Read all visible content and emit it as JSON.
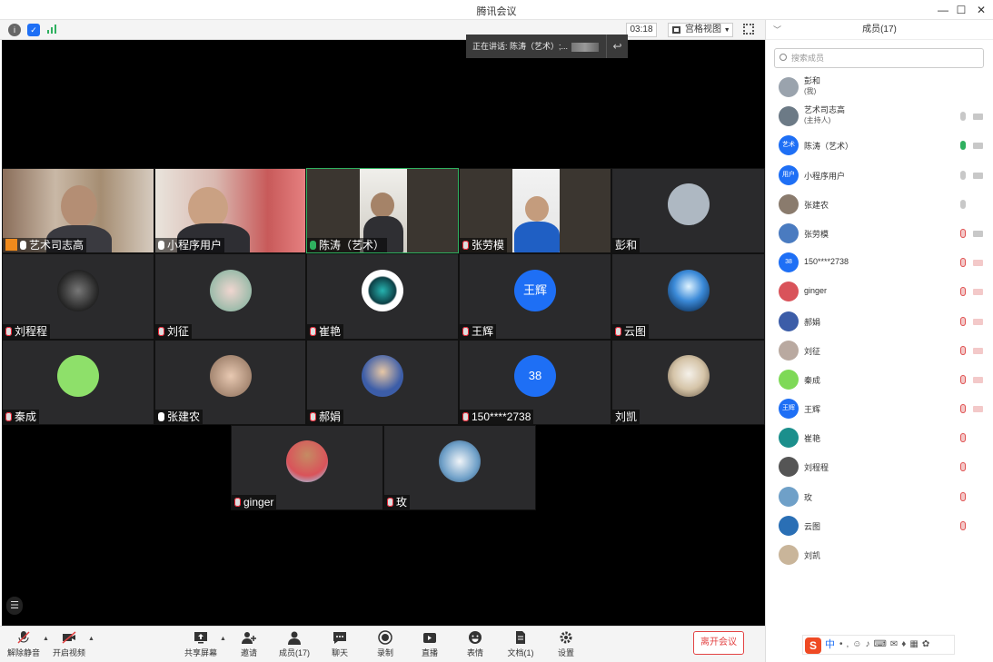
{
  "window": {
    "title": "腾讯会议"
  },
  "toolbar": {
    "timer": "03:18",
    "view_label": "宫格视图"
  },
  "speaker": {
    "prefix": "正在讲话: 陈涛（艺术）;..."
  },
  "colors": {
    "accent": "#1e6ff5",
    "danger": "#e34444",
    "active_border": "#2fb05f",
    "mic_on": "#2fb05f",
    "mic_muted": "#e05050"
  },
  "tiles": [
    {
      "name": "艺术司志高",
      "mic": "on",
      "host": true,
      "type": "video"
    },
    {
      "name": "小程序用户",
      "mic": "on",
      "type": "video"
    },
    {
      "name": "陈涛（艺术）",
      "mic": "on",
      "type": "video",
      "active": true
    },
    {
      "name": "张劳模",
      "mic": "muted",
      "type": "video"
    },
    {
      "name": "彭和",
      "mic": "none",
      "type": "avatar"
    },
    {
      "name": "刘程程",
      "mic": "muted",
      "type": "avatar"
    },
    {
      "name": "刘征",
      "mic": "muted",
      "type": "avatar"
    },
    {
      "name": "崔艳",
      "mic": "muted",
      "type": "avatar"
    },
    {
      "name": "王辉",
      "mic": "muted",
      "type": "avatar",
      "avatar_text": "王辉"
    },
    {
      "name": "云图",
      "mic": "muted",
      "type": "avatar"
    },
    {
      "name": "秦成",
      "mic": "muted",
      "type": "avatar"
    },
    {
      "name": "张建农",
      "mic": "on",
      "type": "avatar"
    },
    {
      "name": "郝娟",
      "mic": "muted",
      "type": "avatar"
    },
    {
      "name": "150****2738",
      "mic": "muted",
      "type": "avatar",
      "avatar_text": "38"
    },
    {
      "name": "刘凯",
      "mic": "none",
      "type": "avatar"
    },
    {
      "name": "ginger",
      "mic": "muted",
      "type": "avatar"
    },
    {
      "name": "玫",
      "mic": "muted",
      "type": "avatar"
    }
  ],
  "bottom": {
    "unmute": "解除静音",
    "video": "开启视频",
    "share": "共享屏幕",
    "invite": "邀请",
    "members": "成员(17)",
    "chat": "聊天",
    "record": "录制",
    "live": "直播",
    "reactions": "表情",
    "docs": "文档(1)",
    "settings": "设置",
    "leave": "离开会议"
  },
  "panel": {
    "title": "成员(17)",
    "search_placeholder": "搜索成员",
    "members": [
      {
        "name": "彭和",
        "sub": "(我)",
        "mic": "none",
        "cam": "none",
        "avatar_color": "#9aa3ad"
      },
      {
        "name": "艺术司志高",
        "sub": "(主持人)",
        "mic": "off-gray",
        "cam": "gray",
        "avatar_color": "#6c7a86"
      },
      {
        "name": "陈涛（艺术）",
        "mic": "on",
        "cam": "gray",
        "avatar_color": "#1e6ff5",
        "avatar_text": "艺术"
      },
      {
        "name": "小程序用户",
        "mic": "off-gray",
        "cam": "gray",
        "avatar_color": "#1e6ff5",
        "avatar_text": "用户"
      },
      {
        "name": "张建农",
        "mic": "off-gray",
        "cam": "none",
        "avatar_color": "#8a7b6d"
      },
      {
        "name": "张劳模",
        "mic": "muted",
        "cam": "gray",
        "avatar_color": "#4a7bc0"
      },
      {
        "name": "150****2738",
        "mic": "muted",
        "cam": "muted",
        "avatar_color": "#1e6ff5",
        "avatar_text": "38"
      },
      {
        "name": "ginger",
        "mic": "muted",
        "cam": "muted",
        "avatar_color": "#d9535a"
      },
      {
        "name": "郝娟",
        "mic": "muted",
        "cam": "muted",
        "avatar_color": "#3c5da8"
      },
      {
        "name": "刘征",
        "mic": "muted",
        "cam": "muted",
        "avatar_color": "#b9a9a0"
      },
      {
        "name": "秦成",
        "mic": "muted",
        "cam": "muted",
        "avatar_color": "#7ed957"
      },
      {
        "name": "王辉",
        "mic": "muted",
        "cam": "muted",
        "avatar_color": "#1e6ff5",
        "avatar_text": "王辉"
      },
      {
        "name": "崔艳",
        "mic": "muted",
        "cam": "none",
        "avatar_color": "#1b8f8c"
      },
      {
        "name": "刘程程",
        "mic": "muted",
        "cam": "none",
        "avatar_color": "#555555"
      },
      {
        "name": "玫",
        "mic": "muted",
        "cam": "none",
        "avatar_color": "#6fa0c8"
      },
      {
        "name": "云图",
        "mic": "muted",
        "cam": "none",
        "avatar_color": "#2a6fb5"
      },
      {
        "name": "刘凯",
        "mic": "none",
        "cam": "none",
        "avatar_color": "#c9b59a"
      }
    ]
  },
  "ime": {
    "label": "中"
  }
}
